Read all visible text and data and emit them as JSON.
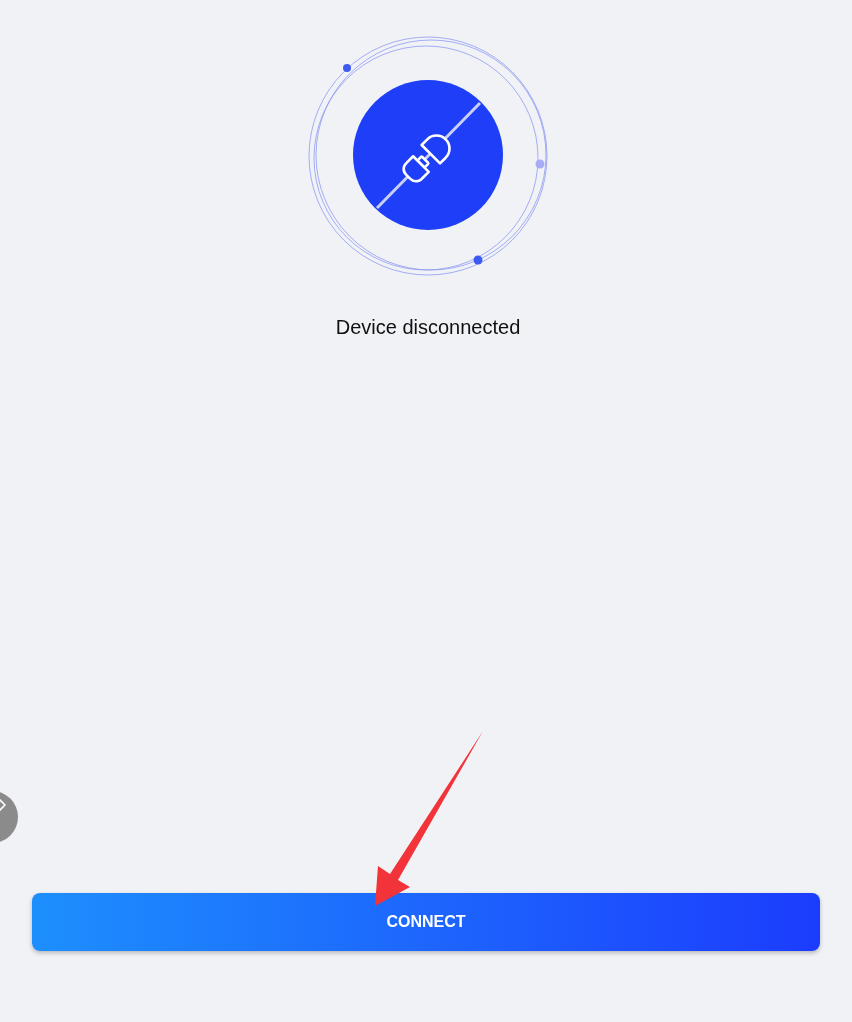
{
  "status": {
    "text": "Device disconnected",
    "connected": false
  },
  "connect_button": {
    "label": "CONNECT"
  }
}
